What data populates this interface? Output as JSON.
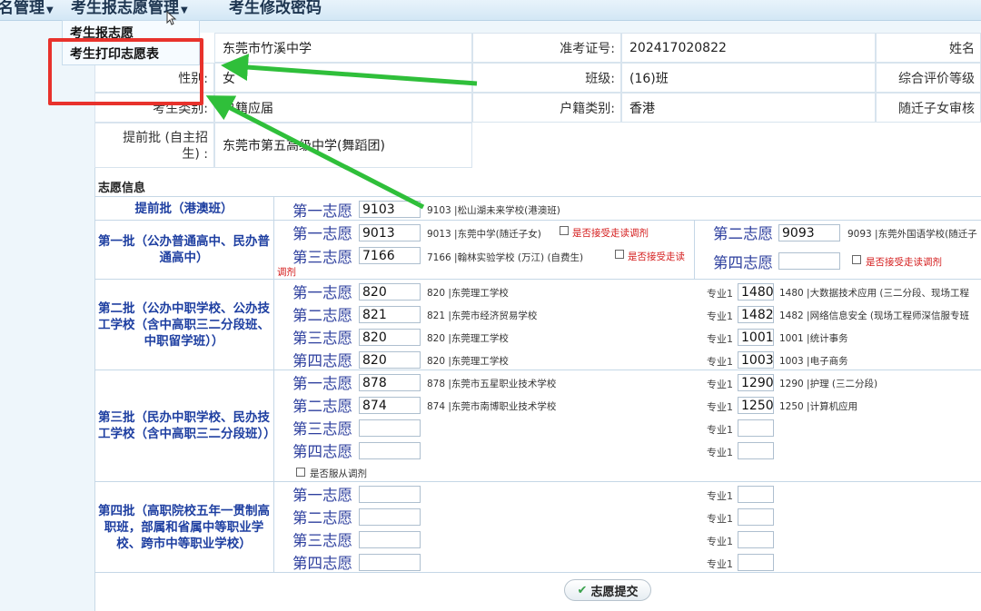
{
  "menu": {
    "left_partial": "名管理",
    "app_manage": "考生报志愿管理",
    "change_pwd": "考生修改密码",
    "dropdown": {
      "item1": "考生报志愿",
      "item2": "考生打印志愿表"
    }
  },
  "info": {
    "school": "东莞市竹溪中学",
    "exam_no_label": "准考证号:",
    "exam_no": "202417020822",
    "name_label": "姓名",
    "gender_label": "性别:",
    "gender": "女",
    "class_label": "班级:",
    "class": "(16)班",
    "eval_label": "综合评价等级",
    "type_label": "考生类别:",
    "type": "户籍应届",
    "hukou_label": "户籍类别:",
    "hukou": "香港",
    "sqzn_label": "随迁子女审核",
    "early_label_1": "提前批 (自主招",
    "early_label_2": "生) :",
    "early_value": "东莞市第五高级中学(舞蹈团)"
  },
  "section_title": "志愿信息",
  "ord": {
    "1": "第一志愿",
    "2": "第二志愿",
    "3": "第三志愿",
    "4": "第四志愿"
  },
  "batches": {
    "early_hkmo": {
      "label": "提前批（港澳班）",
      "c1_code": "9103",
      "c1_school": "9103 |松山湖未来学校(港澳班)"
    },
    "b1": {
      "label": "第一批（公办普通高中、民办普通高中）",
      "c1_code": "9013",
      "c1_school": "9013 |东莞中学(随迁子女)",
      "c2_code": "9093",
      "c2_school": "9093 |东莞外国语学校(随迁子",
      "c3_code": "7166",
      "c3_school": "7166 |翰林实验学校 (万江) (自费生)",
      "adjust": "是否接受走读调剂",
      "adjust_short": "是否接受走读",
      "adjust_wrap": "调剂"
    },
    "b2": {
      "label": "第二批（公办中职学校、公办技工学校（含中高职三二分段班、中职留学班））",
      "major_label": "专业1",
      "rows": [
        {
          "code": "820",
          "school": "820 |东莞理工学校",
          "major": "1480",
          "major_name": "1480 |大数据技术应用 (三二分段、现场工程"
        },
        {
          "code": "821",
          "school": "821 |东莞市经济贸易学校",
          "major": "1482",
          "major_name": "1482 |网络信息安全 (现场工程师深信服专班"
        },
        {
          "code": "820",
          "school": "820 |东莞理工学校",
          "major": "1001",
          "major_name": "1001 |统计事务"
        },
        {
          "code": "820",
          "school": "820 |东莞理工学校",
          "major": "1003",
          "major_name": "1003 |电子商务"
        }
      ]
    },
    "b3": {
      "label": "第三批（民办中职学校、民办技工学校（含中高职三二分段班））",
      "rows": [
        {
          "code": "878",
          "school": "878 |东莞市五星职业技术学校",
          "major": "1290",
          "major_name": "1290 |护理 (三二分段)"
        },
        {
          "code": "874",
          "school": "874 |东莞市南博职业技术学校",
          "major": "1250",
          "major_name": "1250 |计算机应用"
        }
      ],
      "obey": "是否服从调剂"
    },
    "b4": {
      "label": "第四批（高职院校五年一贯制高职班，部属和省属中等职业学校、跨市中等职业学校）"
    }
  },
  "submit_label": "志愿提交",
  "colors": {
    "highlight": "#e8322c",
    "arrow": "#2fbf3a",
    "batch_text": "#1e3fa1"
  }
}
